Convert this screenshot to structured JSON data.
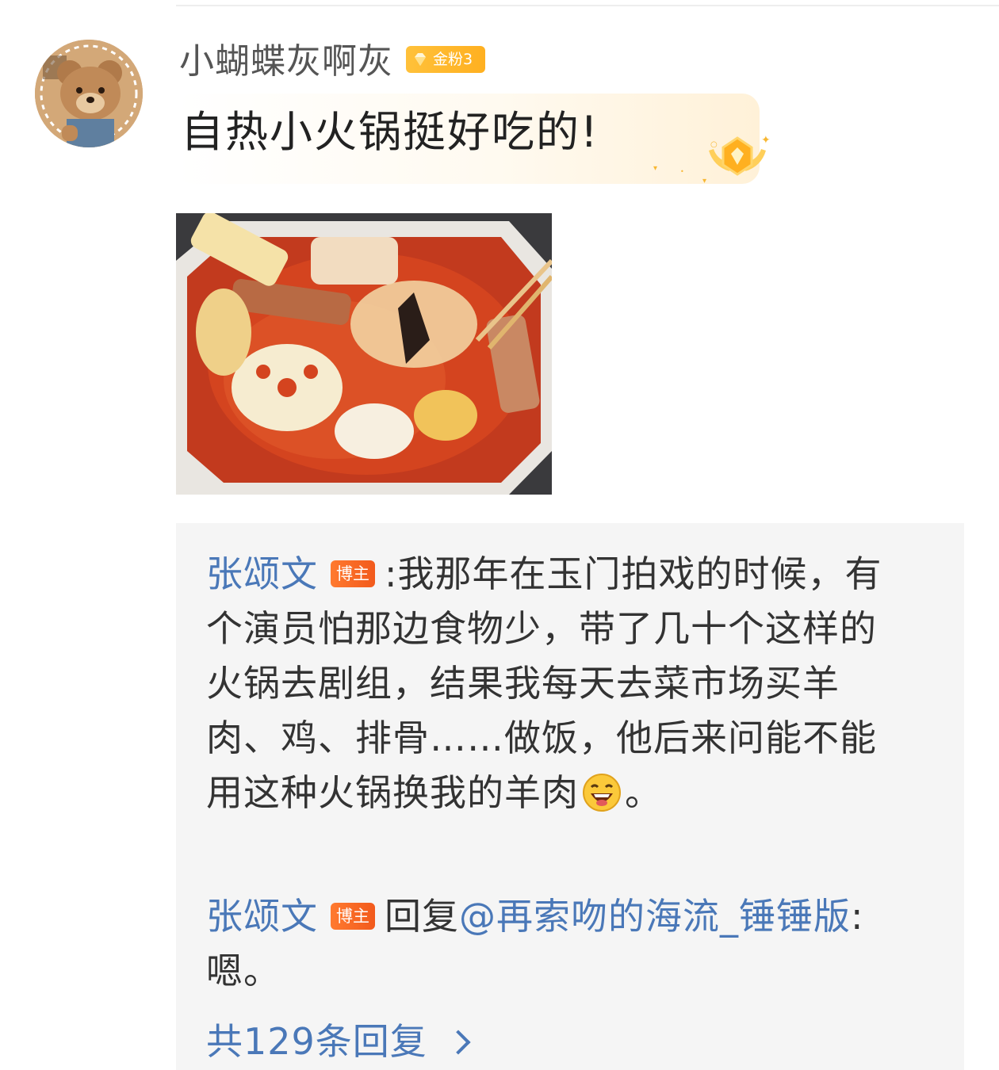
{
  "post": {
    "username": "小蝴蝶灰啊灰",
    "fan_badge": "金粉3",
    "comment": "自热小火锅挺好吃的!"
  },
  "replies": [
    {
      "author": "张颂文",
      "badge": "博主",
      "separator": ":",
      "text_before_emoji": "我那年在玉门拍戏的时候，有个演员怕那边食物少，带了几十个这样的火锅去剧组，结果我每天去菜市场买羊肉、鸡、排骨……做饭，他后来问能不能用这种火锅换我的羊肉",
      "emoji": "grinning-face",
      "text_after_emoji": "。"
    },
    {
      "author": "张颂文",
      "badge": "博主",
      "reply_prefix": "回复",
      "mention": "@再索吻的海流_锤锤版",
      "separator": ":",
      "text": "嗯。"
    }
  ],
  "more_replies": "共129条回复",
  "colors": {
    "link_blue": "#4a78b8",
    "owner_badge": "#f25a1c",
    "fan_badge": "#ffb020",
    "reply_bg": "#f5f5f5"
  }
}
